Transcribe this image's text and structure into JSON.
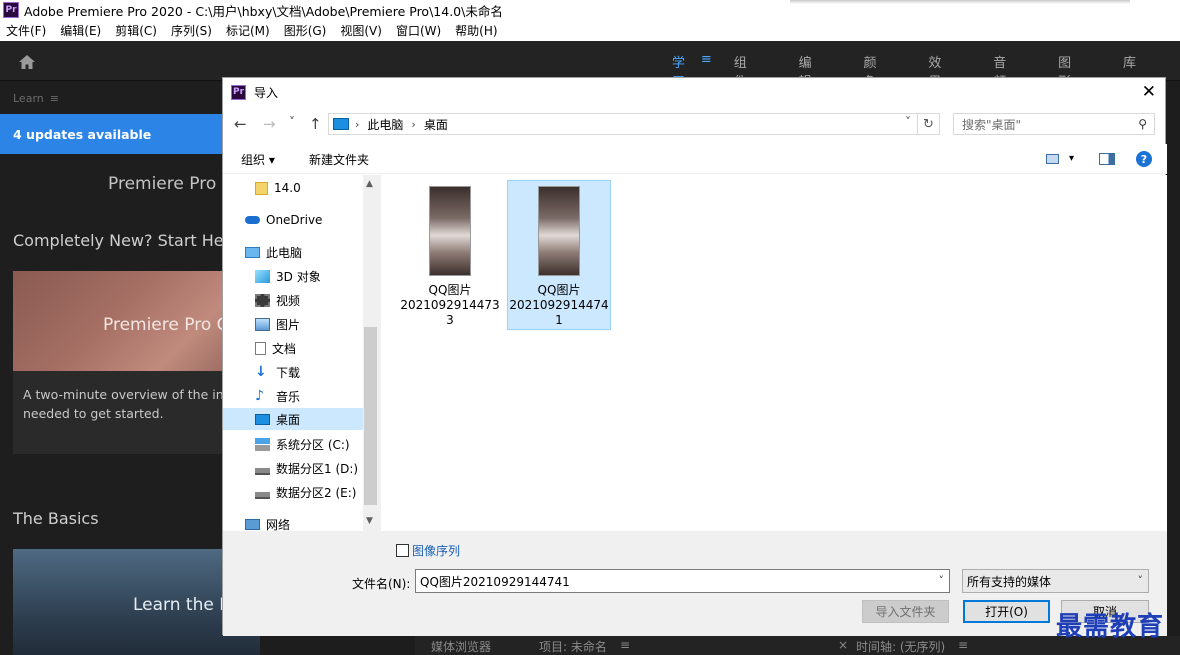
{
  "app": {
    "window_title": "Adobe Premiere Pro 2020 - C:\\用户\\hbxy\\文档\\Adobe\\Premiere Pro\\14.0\\未命名",
    "logo_text": "Pr",
    "menu": [
      "文件(F)",
      "编辑(E)",
      "剪辑(C)",
      "序列(S)",
      "标记(M)",
      "图形(G)",
      "视图(V)",
      "窗口(W)",
      "帮助(H)"
    ],
    "workspaces": {
      "active": "学习",
      "menu_glyph": "≡",
      "items": [
        "组件",
        "编辑",
        "颜色",
        "效果",
        "音频",
        "图形",
        "库"
      ]
    }
  },
  "learn_panel": {
    "header": "Learn",
    "menu_glyph": "≡",
    "updates_banner": "4 updates available",
    "product_title": "Premiere Pro",
    "section_new": "Completely New? Start Here",
    "card1_title": "Premiere Pro C",
    "card1_desc_line1": "A two-minute overview of the in",
    "card1_desc_line2": "needed to get started.",
    "section_basics": "The Basics",
    "card2_title": "Learn the I"
  },
  "bottom_panels": {
    "media_browser": "媒体浏览器",
    "project": "项目: 未命名",
    "menu_glyph": "≡",
    "timeline": "时间轴: (无序列)",
    "close_glyph": "×"
  },
  "dialog": {
    "title": "导入",
    "close": "✕",
    "nav": {
      "back": "←",
      "forward": "→",
      "recent": "˅",
      "up": "↑"
    },
    "address": {
      "crumb1": "此电脑",
      "crumb2": "桌面",
      "sep": "›",
      "dropdown": "˅",
      "refresh": "↻"
    },
    "search": {
      "placeholder": "搜索\"桌面\"",
      "icon": "⚲"
    },
    "toolbar": {
      "organize": "组织 ▾",
      "new_folder": "新建文件夹",
      "view_menu": "▾",
      "help": "?"
    },
    "tree": [
      {
        "label": "14.0",
        "icon": "folder-icon",
        "indent": 1
      },
      {
        "label": "OneDrive",
        "icon": "cloud-icon",
        "indent": 0
      },
      {
        "label": "此电脑",
        "icon": "computer-icon",
        "indent": 0
      },
      {
        "label": "3D 对象",
        "icon": "cube-icon",
        "indent": 1
      },
      {
        "label": "视频",
        "icon": "video-icon",
        "indent": 1
      },
      {
        "label": "图片",
        "icon": "picture-icon",
        "indent": 1
      },
      {
        "label": "文档",
        "icon": "document-icon",
        "indent": 1
      },
      {
        "label": "下载",
        "icon": "download-icon",
        "indent": 1
      },
      {
        "label": "音乐",
        "icon": "music-icon",
        "indent": 1
      },
      {
        "label": "桌面",
        "icon": "desktop-icon",
        "indent": 1,
        "selected": true
      },
      {
        "label": "系统分区 (C:)",
        "icon": "windows-drive-icon",
        "indent": 1
      },
      {
        "label": "数据分区1 (D:)",
        "icon": "drive-icon",
        "indent": 1
      },
      {
        "label": "数据分区2 (E:)",
        "icon": "drive-icon",
        "indent": 1
      },
      {
        "label": "网络",
        "icon": "network-icon",
        "indent": 0
      }
    ],
    "scroll_arrows": {
      "up": "▲",
      "down": "▼"
    },
    "files": [
      {
        "line1": "QQ图片",
        "line2": "2021092914473",
        "line3": "3",
        "selected": false
      },
      {
        "line1": "QQ图片",
        "line2": "2021092914474",
        "line3": "1",
        "selected": true
      }
    ],
    "image_sequence_label": "图像序列",
    "filename_label": "文件名(N):",
    "filename_value": "QQ图片20210929144741",
    "filetype_value": "所有支持的媒体",
    "dropdown_glyph": "˅",
    "buttons": {
      "import_folder": "导入文件夹",
      "open": "打开(O)",
      "cancel": "取消"
    }
  },
  "watermark": "最需教育",
  "colors": {
    "accent_blue": "#2b84e6",
    "selection": "#cce8ff",
    "workspace_active": "#4aa8ff"
  }
}
